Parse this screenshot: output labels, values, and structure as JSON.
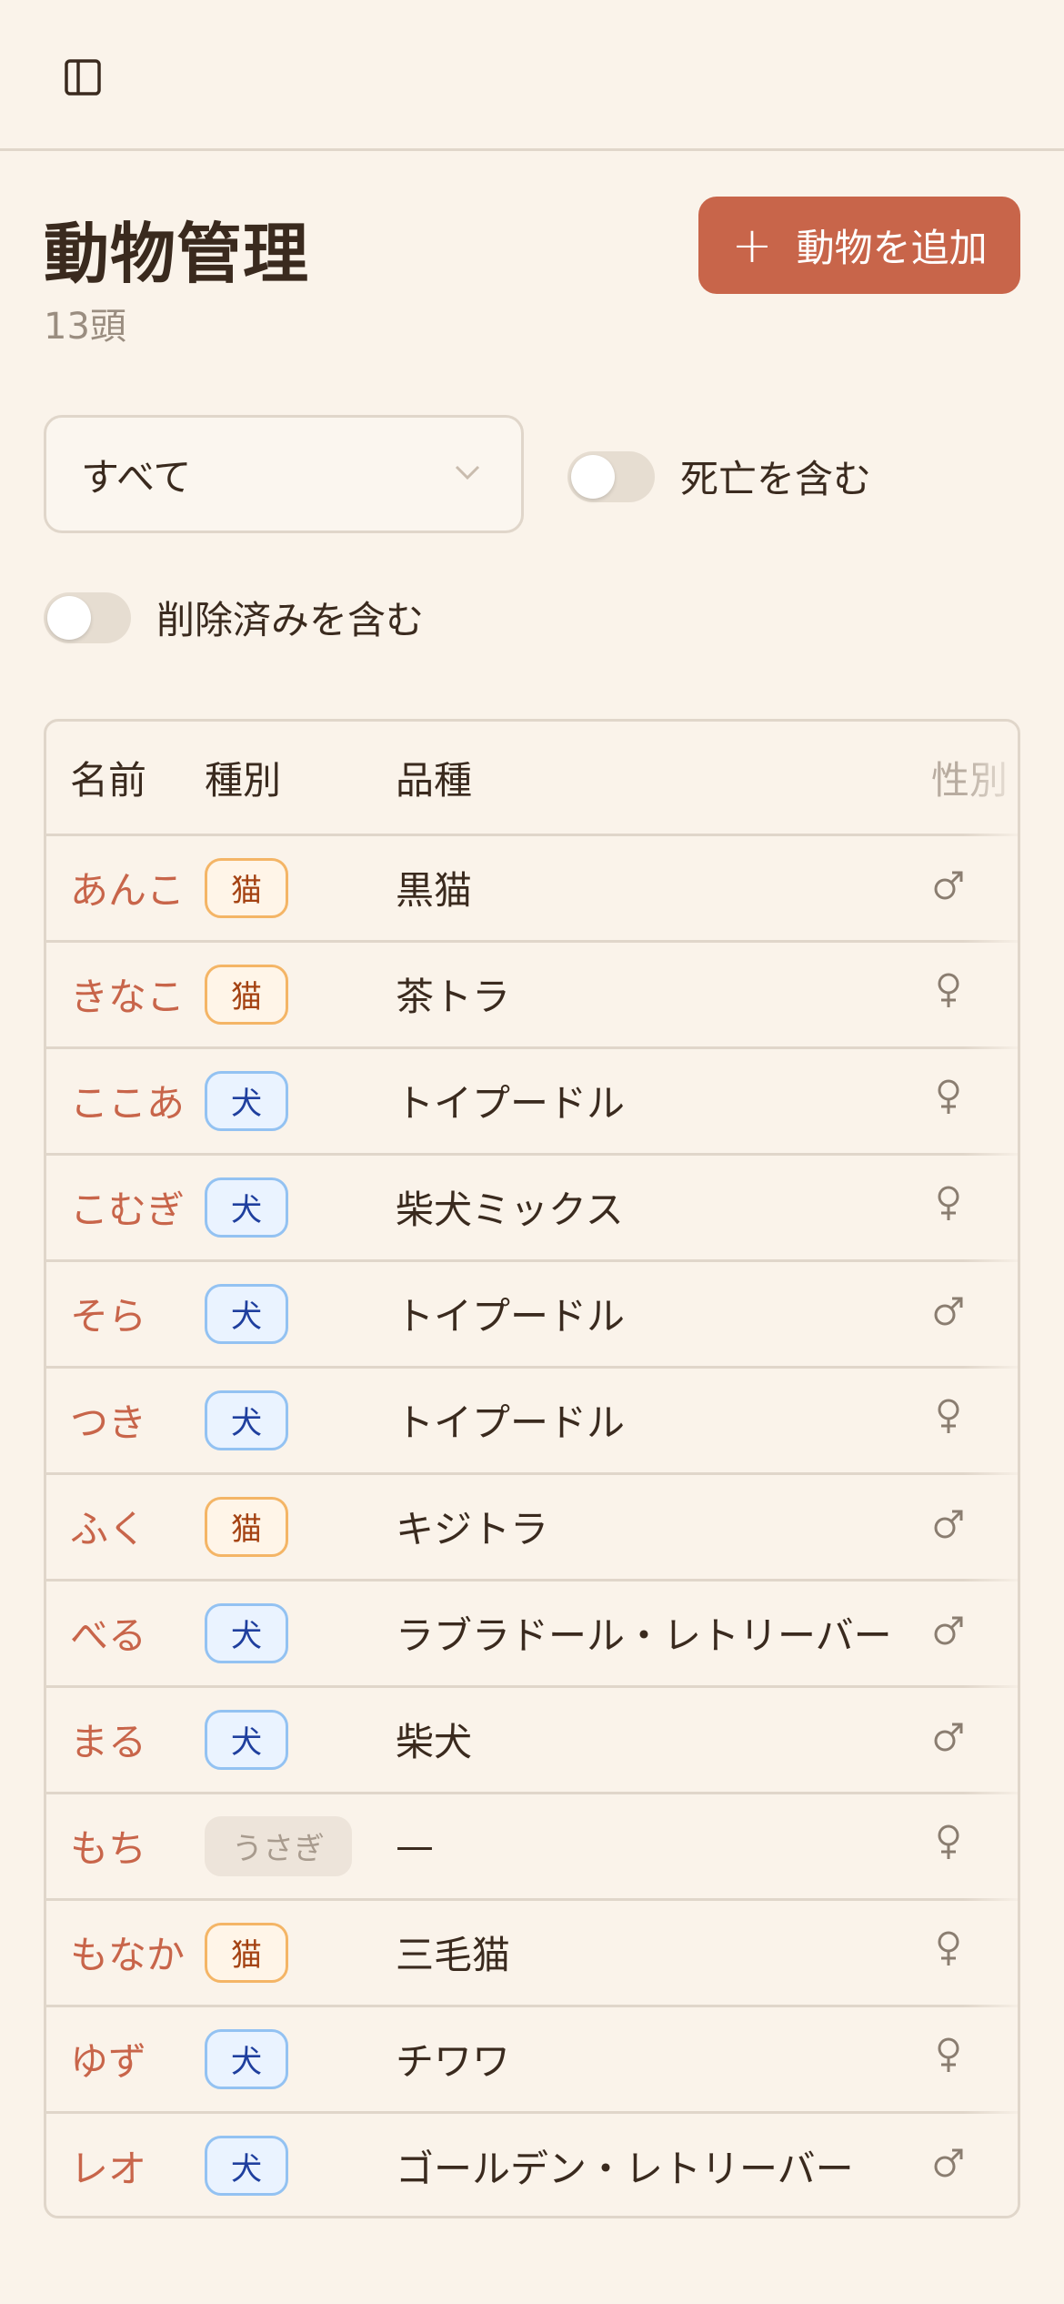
{
  "header": {
    "sidebar_icon": "sidebar-panel-icon"
  },
  "page": {
    "title": "動物管理",
    "count": "13頭",
    "add_button": {
      "icon": "plus-icon",
      "label": "動物を追加"
    }
  },
  "filters": {
    "species_select": {
      "value": "すべて"
    },
    "include_dead": {
      "label": "死亡を含む",
      "checked": false
    },
    "include_deleted": {
      "label": "削除済みを含む",
      "checked": false
    }
  },
  "table": {
    "columns": [
      "名前",
      "種別",
      "品種",
      "性別"
    ],
    "rows": [
      {
        "name": "あんこ",
        "species": "猫",
        "kind": "cat",
        "breed": "黒猫",
        "sex": "male"
      },
      {
        "name": "きなこ",
        "species": "猫",
        "kind": "cat",
        "breed": "茶トラ",
        "sex": "female"
      },
      {
        "name": "ここあ",
        "species": "犬",
        "kind": "dog",
        "breed": "トイプードル",
        "sex": "female"
      },
      {
        "name": "こむぎ",
        "species": "犬",
        "kind": "dog",
        "breed": "柴犬ミックス",
        "sex": "female"
      },
      {
        "name": "そら",
        "species": "犬",
        "kind": "dog",
        "breed": "トイプードル",
        "sex": "male"
      },
      {
        "name": "つき",
        "species": "犬",
        "kind": "dog",
        "breed": "トイプードル",
        "sex": "female"
      },
      {
        "name": "ふく",
        "species": "猫",
        "kind": "cat",
        "breed": "キジトラ",
        "sex": "male"
      },
      {
        "name": "べる",
        "species": "犬",
        "kind": "dog",
        "breed": "ラブラドール・レトリーバー",
        "sex": "male"
      },
      {
        "name": "まる",
        "species": "犬",
        "kind": "dog",
        "breed": "柴犬",
        "sex": "male"
      },
      {
        "name": "もち",
        "species": "うさぎ",
        "kind": "other",
        "breed": "—",
        "sex": "female"
      },
      {
        "name": "もなか",
        "species": "猫",
        "kind": "cat",
        "breed": "三毛猫",
        "sex": "female"
      },
      {
        "name": "ゆず",
        "species": "犬",
        "kind": "dog",
        "breed": "チワワ",
        "sex": "female"
      },
      {
        "name": "レオ",
        "species": "犬",
        "kind": "dog",
        "breed": "ゴールデン・レトリーバー",
        "sex": "male"
      }
    ]
  },
  "colors": {
    "background": "#faf3ea",
    "accent": "#c8654a",
    "cat_badge_border": "#f4b566",
    "dog_badge_border": "#93c2f2"
  }
}
